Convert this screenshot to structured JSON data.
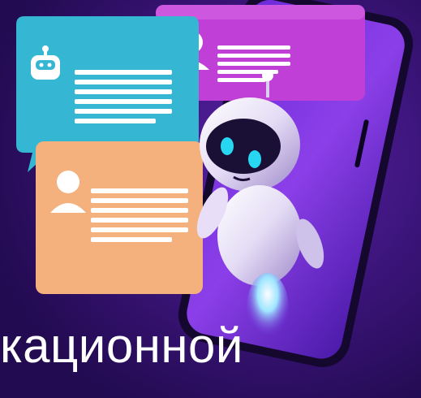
{
  "caption": "кационной",
  "colors": {
    "background": "#2a0f5e",
    "phone_frame": "#15082f",
    "bubble_magenta": "#c03fd6",
    "bubble_cyan": "#35b7d3",
    "bubble_peach": "#f4b17d",
    "robot_eyes": "#27d7f2"
  },
  "icons": {
    "robot": "robot-avatar-icon",
    "user_top": "user-silhouette-icon",
    "user_bottom": "user-silhouette-icon"
  }
}
